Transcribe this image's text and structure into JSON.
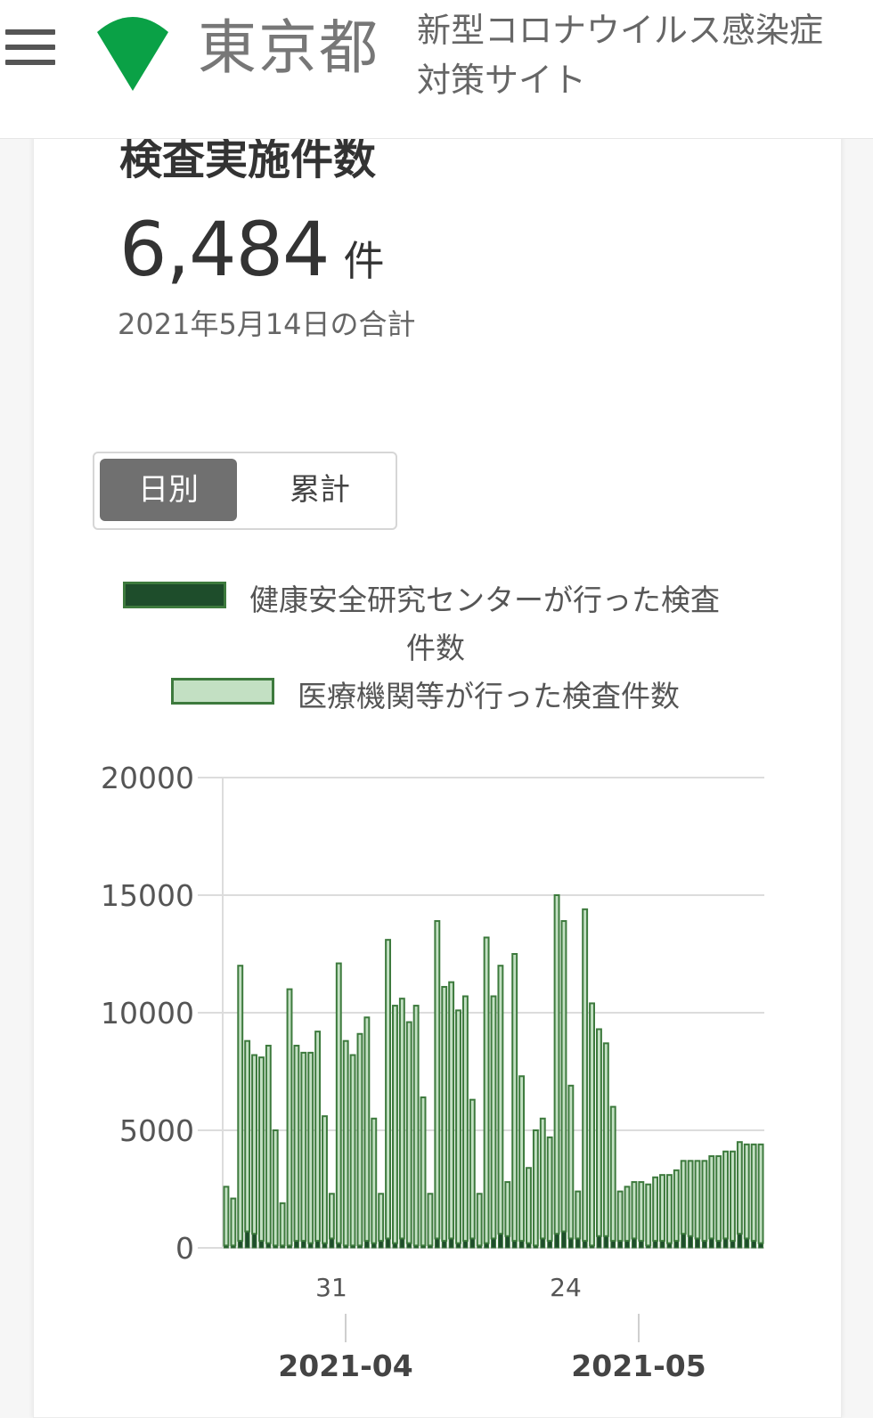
{
  "header": {
    "logo_text": "東京都",
    "site_title_line1": "新型コロナウイルス感染症",
    "site_title_line2": "対策サイト"
  },
  "card": {
    "title": "検査実施件数",
    "total_value": "6,484",
    "total_unit": "件",
    "date_note": "2021年5月14日の合計"
  },
  "toggle": {
    "daily_label": "日別",
    "cumulative_label": "累計",
    "selected": "daily"
  },
  "legend": {
    "series1_line1": "健康安全研究センターが行った検査",
    "series1_line2": "件数",
    "series2": "医療機関等が行った検査件数"
  },
  "colors": {
    "series1": "#1e4d2b",
    "series2": "#c3e0c3",
    "bar_stroke": "#3d7a3d"
  },
  "chart_data": {
    "type": "bar",
    "stacked": true,
    "ylim": [
      0,
      20000
    ],
    "yticks": [
      "20000",
      "15000",
      "10000",
      "5000",
      "0"
    ],
    "x_tick_labels": [
      "31",
      "24"
    ],
    "x_month_labels": [
      "2021-04",
      "2021-05"
    ],
    "series": [
      {
        "name": "健康安全研究センターが行った検査件数",
        "values": [
          100,
          100,
          300,
          700,
          600,
          300,
          200,
          100,
          100,
          100,
          300,
          300,
          200,
          300,
          200,
          400,
          200,
          100,
          100,
          100,
          300,
          200,
          300,
          400,
          200,
          400,
          200,
          100,
          100,
          100,
          400,
          300,
          400,
          200,
          300,
          400,
          100,
          200,
          400,
          600,
          500,
          300,
          300,
          200,
          100,
          400,
          300,
          600,
          700,
          400,
          400,
          300,
          100,
          500,
          500,
          300,
          300,
          300,
          400,
          300,
          100,
          300,
          300,
          200,
          300,
          600,
          500,
          400,
          300,
          400,
          300,
          400,
          300,
          600,
          400,
          300,
          200
        ]
      },
      {
        "name": "医療機関等が行った検査件数",
        "values": [
          2500,
          2000,
          11700,
          8100,
          7600,
          7800,
          8400,
          4900,
          1800,
          10900,
          8300,
          8000,
          8100,
          8900,
          5400,
          1900,
          11900,
          8700,
          8100,
          9000,
          9500,
          5300,
          2000,
          12700,
          10100,
          10200,
          9400,
          10200,
          6300,
          2200,
          13500,
          10800,
          10900,
          9900,
          10400,
          5900,
          2200,
          13000,
          10300,
          11400,
          2300,
          12200,
          7000,
          3200,
          4900,
          5100,
          4400,
          14400,
          13200,
          6500,
          2000,
          14100,
          10300,
          8800,
          8200,
          5700,
          2100,
          2300,
          2400,
          2500,
          2600,
          2700,
          2800,
          2900,
          3000,
          3100,
          3200,
          3300,
          3400,
          3500,
          3600,
          3700,
          3800,
          3900,
          4000,
          4100,
          4200
        ]
      }
    ]
  }
}
